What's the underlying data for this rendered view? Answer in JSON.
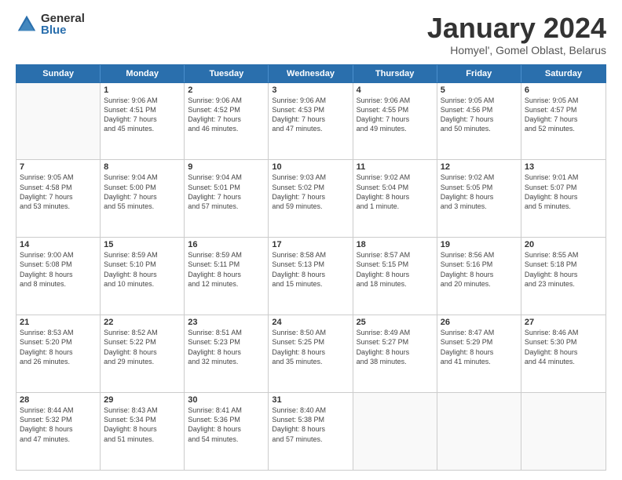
{
  "logo": {
    "general": "General",
    "blue": "Blue"
  },
  "title": "January 2024",
  "subtitle": "Homyel', Gomel Oblast, Belarus",
  "days": [
    "Sunday",
    "Monday",
    "Tuesday",
    "Wednesday",
    "Thursday",
    "Friday",
    "Saturday"
  ],
  "weeks": [
    [
      {
        "num": "",
        "empty": true
      },
      {
        "num": "1",
        "lines": [
          "Sunrise: 9:06 AM",
          "Sunset: 4:51 PM",
          "Daylight: 7 hours",
          "and 45 minutes."
        ]
      },
      {
        "num": "2",
        "lines": [
          "Sunrise: 9:06 AM",
          "Sunset: 4:52 PM",
          "Daylight: 7 hours",
          "and 46 minutes."
        ]
      },
      {
        "num": "3",
        "lines": [
          "Sunrise: 9:06 AM",
          "Sunset: 4:53 PM",
          "Daylight: 7 hours",
          "and 47 minutes."
        ]
      },
      {
        "num": "4",
        "lines": [
          "Sunrise: 9:06 AM",
          "Sunset: 4:55 PM",
          "Daylight: 7 hours",
          "and 49 minutes."
        ]
      },
      {
        "num": "5",
        "lines": [
          "Sunrise: 9:05 AM",
          "Sunset: 4:56 PM",
          "Daylight: 7 hours",
          "and 50 minutes."
        ]
      },
      {
        "num": "6",
        "lines": [
          "Sunrise: 9:05 AM",
          "Sunset: 4:57 PM",
          "Daylight: 7 hours",
          "and 52 minutes."
        ]
      }
    ],
    [
      {
        "num": "7",
        "lines": [
          "Sunrise: 9:05 AM",
          "Sunset: 4:58 PM",
          "Daylight: 7 hours",
          "and 53 minutes."
        ]
      },
      {
        "num": "8",
        "lines": [
          "Sunrise: 9:04 AM",
          "Sunset: 5:00 PM",
          "Daylight: 7 hours",
          "and 55 minutes."
        ]
      },
      {
        "num": "9",
        "lines": [
          "Sunrise: 9:04 AM",
          "Sunset: 5:01 PM",
          "Daylight: 7 hours",
          "and 57 minutes."
        ]
      },
      {
        "num": "10",
        "lines": [
          "Sunrise: 9:03 AM",
          "Sunset: 5:02 PM",
          "Daylight: 7 hours",
          "and 59 minutes."
        ]
      },
      {
        "num": "11",
        "lines": [
          "Sunrise: 9:02 AM",
          "Sunset: 5:04 PM",
          "Daylight: 8 hours",
          "and 1 minute."
        ]
      },
      {
        "num": "12",
        "lines": [
          "Sunrise: 9:02 AM",
          "Sunset: 5:05 PM",
          "Daylight: 8 hours",
          "and 3 minutes."
        ]
      },
      {
        "num": "13",
        "lines": [
          "Sunrise: 9:01 AM",
          "Sunset: 5:07 PM",
          "Daylight: 8 hours",
          "and 5 minutes."
        ]
      }
    ],
    [
      {
        "num": "14",
        "lines": [
          "Sunrise: 9:00 AM",
          "Sunset: 5:08 PM",
          "Daylight: 8 hours",
          "and 8 minutes."
        ]
      },
      {
        "num": "15",
        "lines": [
          "Sunrise: 8:59 AM",
          "Sunset: 5:10 PM",
          "Daylight: 8 hours",
          "and 10 minutes."
        ]
      },
      {
        "num": "16",
        "lines": [
          "Sunrise: 8:59 AM",
          "Sunset: 5:11 PM",
          "Daylight: 8 hours",
          "and 12 minutes."
        ]
      },
      {
        "num": "17",
        "lines": [
          "Sunrise: 8:58 AM",
          "Sunset: 5:13 PM",
          "Daylight: 8 hours",
          "and 15 minutes."
        ]
      },
      {
        "num": "18",
        "lines": [
          "Sunrise: 8:57 AM",
          "Sunset: 5:15 PM",
          "Daylight: 8 hours",
          "and 18 minutes."
        ]
      },
      {
        "num": "19",
        "lines": [
          "Sunrise: 8:56 AM",
          "Sunset: 5:16 PM",
          "Daylight: 8 hours",
          "and 20 minutes."
        ]
      },
      {
        "num": "20",
        "lines": [
          "Sunrise: 8:55 AM",
          "Sunset: 5:18 PM",
          "Daylight: 8 hours",
          "and 23 minutes."
        ]
      }
    ],
    [
      {
        "num": "21",
        "lines": [
          "Sunrise: 8:53 AM",
          "Sunset: 5:20 PM",
          "Daylight: 8 hours",
          "and 26 minutes."
        ]
      },
      {
        "num": "22",
        "lines": [
          "Sunrise: 8:52 AM",
          "Sunset: 5:22 PM",
          "Daylight: 8 hours",
          "and 29 minutes."
        ]
      },
      {
        "num": "23",
        "lines": [
          "Sunrise: 8:51 AM",
          "Sunset: 5:23 PM",
          "Daylight: 8 hours",
          "and 32 minutes."
        ]
      },
      {
        "num": "24",
        "lines": [
          "Sunrise: 8:50 AM",
          "Sunset: 5:25 PM",
          "Daylight: 8 hours",
          "and 35 minutes."
        ]
      },
      {
        "num": "25",
        "lines": [
          "Sunrise: 8:49 AM",
          "Sunset: 5:27 PM",
          "Daylight: 8 hours",
          "and 38 minutes."
        ]
      },
      {
        "num": "26",
        "lines": [
          "Sunrise: 8:47 AM",
          "Sunset: 5:29 PM",
          "Daylight: 8 hours",
          "and 41 minutes."
        ]
      },
      {
        "num": "27",
        "lines": [
          "Sunrise: 8:46 AM",
          "Sunset: 5:30 PM",
          "Daylight: 8 hours",
          "and 44 minutes."
        ]
      }
    ],
    [
      {
        "num": "28",
        "lines": [
          "Sunrise: 8:44 AM",
          "Sunset: 5:32 PM",
          "Daylight: 8 hours",
          "and 47 minutes."
        ]
      },
      {
        "num": "29",
        "lines": [
          "Sunrise: 8:43 AM",
          "Sunset: 5:34 PM",
          "Daylight: 8 hours",
          "and 51 minutes."
        ]
      },
      {
        "num": "30",
        "lines": [
          "Sunrise: 8:41 AM",
          "Sunset: 5:36 PM",
          "Daylight: 8 hours",
          "and 54 minutes."
        ]
      },
      {
        "num": "31",
        "lines": [
          "Sunrise: 8:40 AM",
          "Sunset: 5:38 PM",
          "Daylight: 8 hours",
          "and 57 minutes."
        ]
      },
      {
        "num": "",
        "empty": true
      },
      {
        "num": "",
        "empty": true
      },
      {
        "num": "",
        "empty": true
      }
    ]
  ]
}
